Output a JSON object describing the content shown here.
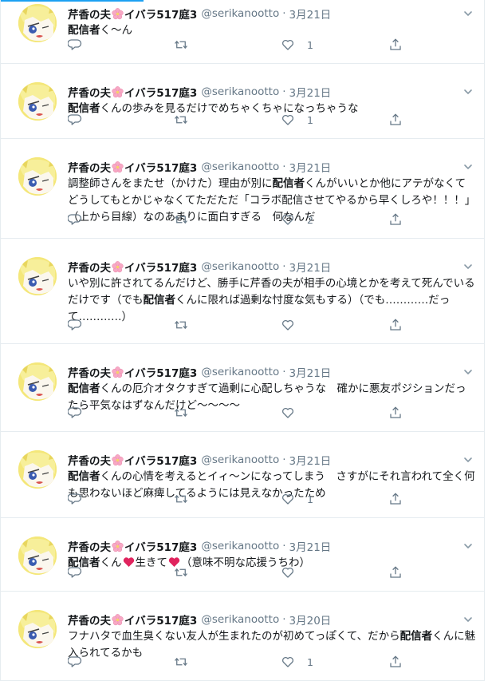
{
  "author": {
    "name_a": "芹香の夫",
    "name_b": "イバラ517庭3",
    "handle": "@serikanootto",
    "separator": "·"
  },
  "tweets": [
    {
      "time": "3月21日",
      "text": [
        {
          "b": "配信者"
        },
        {
          "t": "く～ん"
        }
      ],
      "replies": "",
      "retweets": "",
      "likes": "1"
    },
    {
      "time": "3月21日",
      "text": [
        {
          "b": "配信者"
        },
        {
          "t": "くんの歩みを見るだけでめちゃくちゃになっちゃうな"
        }
      ],
      "replies": "",
      "retweets": "",
      "likes": "1"
    },
    {
      "time": "3月21日",
      "text": [
        {
          "t": "調整師さんをまたせ（かけた）理由が別に"
        },
        {
          "b": "配信者"
        },
        {
          "t": "くんがいいとか他にアテがなくてどうしてもとかじゃなくてただただ「コラボ配信させてやるから早くしろや！！！」（上から目線）なのあまりに面白すぎる　何なんだ"
        }
      ],
      "replies": "",
      "retweets": "",
      "likes": "2"
    },
    {
      "time": "3月21日",
      "text": [
        {
          "t": "いや別に許されてるんだけど、勝手に芹香の夫が相手の心境とかを考えて死んでいるだけです（でも"
        },
        {
          "b": "配信者"
        },
        {
          "t": "くんに限れば過剰な忖度な気もする）（でも…………だって…………）"
        }
      ],
      "replies": "",
      "retweets": "",
      "likes": ""
    },
    {
      "time": "3月21日",
      "text": [
        {
          "b": "配信者"
        },
        {
          "t": "くんの厄介オタクすぎて過剰に心配しちゃうな　確かに悪友ポジションだったら平気なはずなんだけど～～～～"
        }
      ],
      "replies": "",
      "retweets": "",
      "likes": ""
    },
    {
      "time": "3月21日",
      "text": [
        {
          "b": "配信者"
        },
        {
          "t": "くんの心情を考えるとイィ～ンになってしまう　さすがにそれ言われて全く何も思わないほど麻痺してるようには見えなかったため"
        }
      ],
      "replies": "",
      "retweets": "",
      "likes": "1"
    },
    {
      "time": "3月21日",
      "text": [
        {
          "b": "配信者"
        },
        {
          "t": "くん"
        },
        {
          "h": "heart"
        },
        {
          "t": "生きて"
        },
        {
          "h": "heart"
        },
        {
          "t": "（意味不明な応援うちわ）"
        }
      ],
      "replies": "",
      "retweets": "",
      "likes": ""
    },
    {
      "time": "3月20日",
      "text": [
        {
          "t": "フナハタで血生臭くない友人が生まれたのが初めてっぽくて、だから"
        },
        {
          "b": "配信者"
        },
        {
          "t": "くんに魅入られてるかも"
        }
      ],
      "replies": "",
      "retweets": "",
      "likes": "1"
    }
  ],
  "icons": {
    "reply": "reply-icon",
    "retweet": "retweet-icon",
    "like": "heart-outline-icon",
    "share": "share-icon",
    "more": "chevron-down-icon",
    "flower": "cherry-blossom-icon",
    "heart_emoji": "red-heart-icon"
  },
  "colors": {
    "accent": "#1da1f2",
    "muted": "#657786",
    "text": "#14171a",
    "divider": "#e6ecf0",
    "heart": "#e0245e"
  }
}
